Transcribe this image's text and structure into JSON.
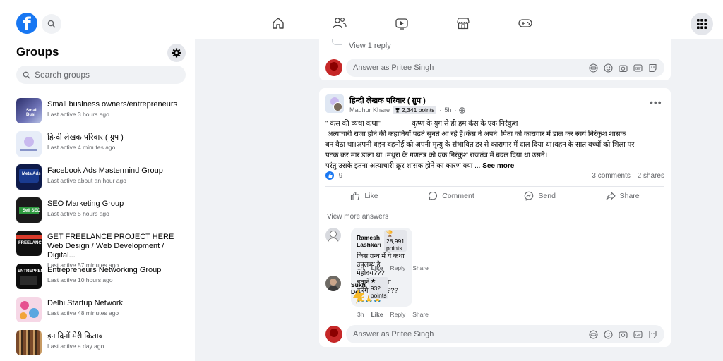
{
  "topnav": {
    "logo_letter": "f",
    "icons": [
      "home-icon",
      "friends-icon",
      "watch-icon",
      "marketplace-icon",
      "gaming-icon"
    ]
  },
  "sidebar": {
    "title": "Groups",
    "search_placeholder": "Search groups",
    "groups": [
      {
        "name": "Small business owners/entrepreneurs",
        "active": "Last active 3 hours ago"
      },
      {
        "name": "हिन्दी लेखक परिवार ( ग्रुप )",
        "active": "Last active 4 minutes ago"
      },
      {
        "name": "Facebook Ads Mastermind Group",
        "active": "Last active about an hour ago"
      },
      {
        "name": "SEO Marketing Group",
        "active": "Last active 5 hours ago"
      },
      {
        "name": "GET FREELANCE PROJECT HERE Web Design / Web Development / Digital...",
        "active": "Last active 57 minutes ago"
      },
      {
        "name": "Entrepreneurs Networking Group",
        "active": "Last active 10 hours ago"
      },
      {
        "name": "Delhi Startup Network",
        "active": "Last active 48 minutes ago"
      },
      {
        "name": "इन दिनों मेरी किताब",
        "active": "Last active a day ago"
      }
    ]
  },
  "feed_top": {
    "view_reply": "View 1 reply",
    "answer_placeholder": "Answer as Pritee Singh"
  },
  "post": {
    "group_name": "हिन्दी लेखक परिवार ( ग्रुप )",
    "author": "Madhur Khare",
    "points": "2,341 points",
    "time": "5h",
    "lines": [
      "\" कंस की व्यथा कथा\"                कृष्ण के युग से ही हम कंस के एक निरंकुश",
      " अत्याचारी राजा होने की कहानियाँ पढ़ते सुनते आ रहे हैं।कंस ने अपने  पिता को कारागार में डाल कर स्वयं निरंकुश शासक",
      "बन बैठा था।अपनी बहन बहनोई को अपनी मृत्यु के संभावित डर से कारागार में दाल दिया था।बहन के सात बच्चों को शिला पर",
      "पटक कर मार डाला था ।मथुरा के गणतंत्र को एक निरंकुश राजतंत्र में बदल दिया था  उसने।",
      "परंतु उसके इतना अत्याचारी क्रूर शासक होने का कारण क्या ..."
    ],
    "see_more": "See more",
    "reactions": "9",
    "comments": "3 comments",
    "shares": "2 shares",
    "actions": {
      "like": "Like",
      "comment": "Comment",
      "send": "Send",
      "share": "Share"
    },
    "view_more": "View more answers",
    "comments_list": [
      {
        "name": "Ramesh Lashkari",
        "badge": "28,991 points",
        "text1": "किस ग्रन्थ में ये कथा उपलब्ध है महोदय???",
        "text2": "बताने की कृपा करेंगे???????? 🙏🙏🙏",
        "time": "1h",
        "like": "Like",
        "reply": "Reply",
        "share": "Share"
      },
      {
        "name": "Sukh Dev",
        "badge": "932 points",
        "time": "3h",
        "like": "Like",
        "reply": "Reply",
        "share": "Share"
      }
    ],
    "answer_placeholder": "Answer as Pritee Singh"
  },
  "colors": {
    "brand": "#1877f2",
    "page_bg": "#f0f2f5"
  }
}
